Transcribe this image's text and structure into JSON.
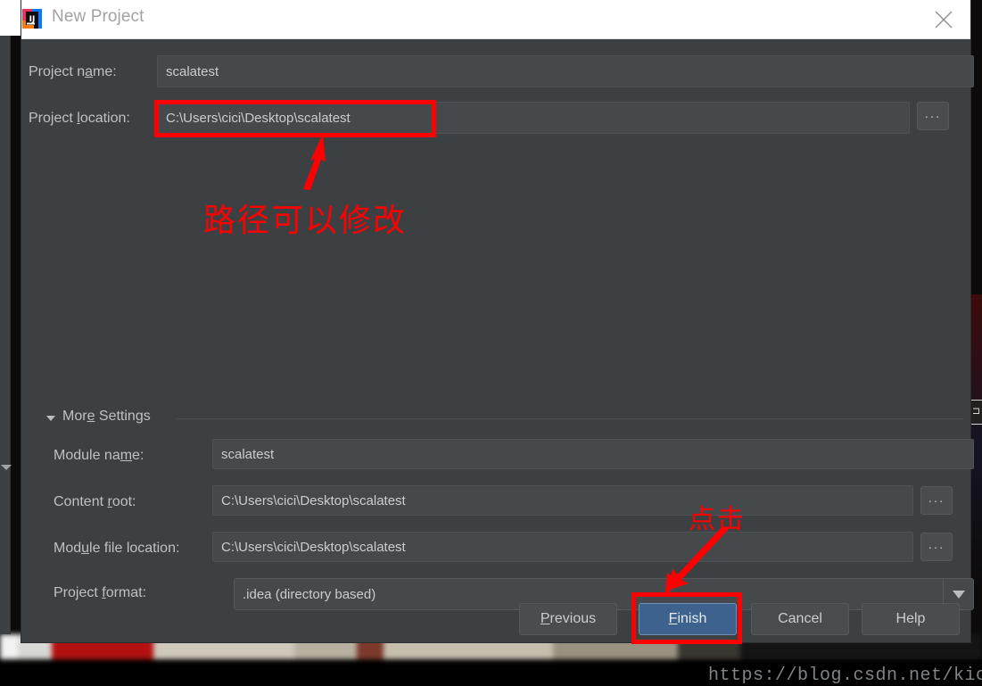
{
  "window": {
    "title": "New Project",
    "app_icon": "intellij-idea-icon",
    "close_icon": "close-icon"
  },
  "form": {
    "project_name": {
      "label_before": "Project n",
      "label_accel": "a",
      "label_after": "me:",
      "value": "scalatest"
    },
    "project_location": {
      "label_before": "Project ",
      "label_accel": "l",
      "label_after": "ocation:",
      "value": "C:\\Users\\cici\\Desktop\\scalatest",
      "browse_label": "..."
    }
  },
  "more_settings": {
    "label_before": "Mor",
    "label_accel": "e",
    "label_after": " Settings",
    "expanded": true,
    "caret_icon": "triangle-down-icon",
    "module_name": {
      "label_before": "Module na",
      "label_accel": "m",
      "label_after": "e:",
      "value": "scalatest"
    },
    "content_root": {
      "label_before": "Content ",
      "label_accel": "r",
      "label_after": "oot:",
      "value": "C:\\Users\\cici\\Desktop\\scalatest",
      "browse_label": "..."
    },
    "module_file_location": {
      "label_before": "Mod",
      "label_accel": "u",
      "label_after": "le file location:",
      "value": "C:\\Users\\cici\\Desktop\\scalatest",
      "browse_label": "..."
    },
    "project_format": {
      "label_before": "Project ",
      "label_accel": "f",
      "label_after": "ormat:",
      "value": ".idea (directory based)",
      "dropdown_icon": "chevron-down-icon"
    }
  },
  "buttons": {
    "previous": {
      "before": "",
      "accel": "P",
      "after": "revious"
    },
    "finish": {
      "before": "",
      "accel": "F",
      "after": "inish"
    },
    "cancel": {
      "before": "Cancel",
      "accel": "",
      "after": ""
    },
    "help": {
      "before": "Help",
      "accel": "",
      "after": ""
    }
  },
  "annotations": {
    "path_note": "路径可以修改",
    "click_note": "点击",
    "accent_color": "#fe0000"
  },
  "watermark": "https://blog.csdn.net/kicilove",
  "background": {
    "window_edge_glyph": "⊐"
  }
}
